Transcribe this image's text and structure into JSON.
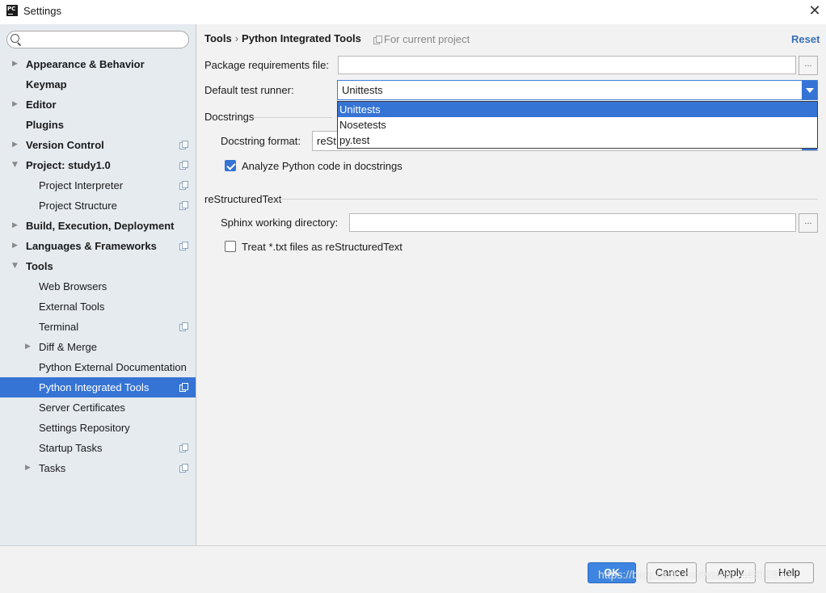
{
  "window": {
    "title": "Settings",
    "app_icon_text": "PC"
  },
  "search": {
    "placeholder": ""
  },
  "sidebar": {
    "items": [
      {
        "label": "Appearance & Behavior"
      },
      {
        "label": "Keymap"
      },
      {
        "label": "Editor"
      },
      {
        "label": "Plugins"
      },
      {
        "label": "Version Control"
      },
      {
        "label": "Project: study1.0"
      },
      {
        "label": "Project Interpreter"
      },
      {
        "label": "Project Structure"
      },
      {
        "label": "Build, Execution, Deployment"
      },
      {
        "label": "Languages & Frameworks"
      },
      {
        "label": "Tools"
      },
      {
        "label": "Web Browsers"
      },
      {
        "label": "External Tools"
      },
      {
        "label": "Terminal"
      },
      {
        "label": "Diff & Merge"
      },
      {
        "label": "Python External Documentation"
      },
      {
        "label": "Python Integrated Tools"
      },
      {
        "label": "Server Certificates"
      },
      {
        "label": "Settings Repository"
      },
      {
        "label": "Startup Tasks"
      },
      {
        "label": "Tasks"
      }
    ]
  },
  "header": {
    "crumb_parent": "Tools",
    "crumb_separator": "›",
    "crumb_current": "Python Integrated Tools",
    "scope": "For current project",
    "reset": "Reset"
  },
  "form": {
    "package_requirements_label": "Package requirements file:",
    "package_requirements_value": "",
    "browse_label": "...",
    "test_runner_label": "Default test runner:",
    "test_runner_value": "Unittests",
    "test_runner_options": [
      "Unittests",
      "Nosetests",
      "py.test"
    ],
    "docstrings_section": "Docstrings",
    "docstring_format_label": "Docstring format:",
    "docstring_format_value": "reSt",
    "analyze_docstrings_label": "Analyze Python code in docstrings",
    "analyze_docstrings_checked": true,
    "rest_section": "reStructuredText",
    "sphinx_dir_label": "Sphinx working directory:",
    "sphinx_dir_value": "",
    "treat_txt_label": "Treat *.txt files as reStructuredText",
    "treat_txt_checked": false
  },
  "buttons": {
    "ok": "OK",
    "cancel": "Cancel",
    "apply": "Apply",
    "help": "Help"
  },
  "watermark": "https://blog.csdn.net/weixin_44812870",
  "colors": {
    "selection": "#3574d4",
    "link": "#3a6fb5",
    "sidebar_bg": "#e6ebf0"
  }
}
